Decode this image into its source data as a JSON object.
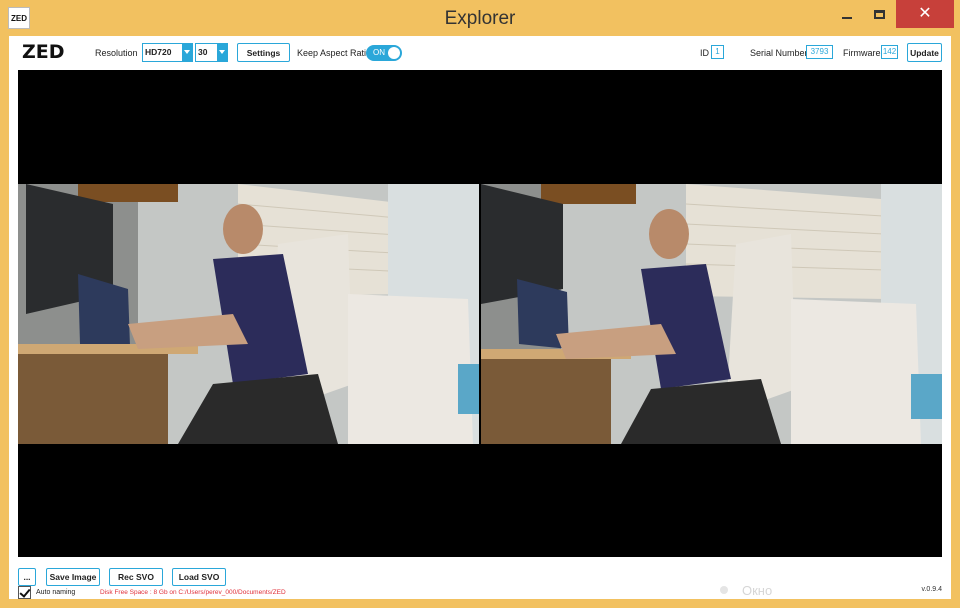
{
  "window": {
    "title": "Explorer",
    "app_icon_text": "ZED",
    "close_symbol": "✕"
  },
  "toolbar": {
    "logo": "ZED",
    "resolution_label": "Resolution",
    "resolution_value": "HD720",
    "fps_value": "30",
    "settings_label": "Settings",
    "keep_aspect_label": "Keep Aspect Ratio",
    "keep_aspect_toggle": "ON",
    "id_label": "ID",
    "id_value": "1",
    "serial_label": "Serial Number",
    "serial_value": "3793",
    "firmware_label": "Firmware",
    "firmware_value": "142",
    "update_label": "Update"
  },
  "bottom": {
    "browse_label": "...",
    "save_image_label": "Save Image",
    "rec_svo_label": "Rec SVO",
    "load_svo_label": "Load SVO",
    "auto_naming_label": "Auto naming",
    "auto_naming_checked": true,
    "disk_info": "Disk Free Space : 8 Gb  on C:/Users/perev_000/Documents/ZED",
    "version": "v.0.9.4",
    "overlay_text": "Окно"
  },
  "colors": {
    "accent": "#2aa7d9",
    "window_frame": "#f2c160",
    "close_button": "#c7403a",
    "disk_info_text": "#e0303a"
  },
  "icons": {
    "dropdown": "chevron-down-icon",
    "minimize": "minimize-icon",
    "maximize": "maximize-icon",
    "close": "close-icon",
    "checkbox": "checkmark-icon"
  }
}
